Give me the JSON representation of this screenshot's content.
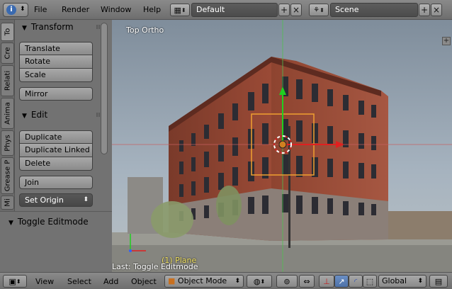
{
  "topbar": {
    "menus": [
      "File",
      "Render",
      "Window",
      "Help"
    ],
    "screen_layout": "Default",
    "scene": "Scene"
  },
  "tabs": [
    "Tools",
    "Create",
    "Relations",
    "Animation",
    "Physics",
    "Grease Pencil",
    "Misc"
  ],
  "tabs_short": [
    "To",
    "Cre",
    "Relati",
    "Anima",
    "Phys",
    "Grease P",
    "Mi"
  ],
  "transform_panel": {
    "title": "Transform",
    "buttons": [
      "Translate",
      "Rotate",
      "Scale",
      "Mirror"
    ]
  },
  "edit_panel": {
    "title": "Edit",
    "buttons": [
      "Duplicate",
      "Duplicate Linked",
      "Delete",
      "Join"
    ],
    "set_origin": "Set Origin"
  },
  "operator_panel": {
    "title": "Toggle Editmode"
  },
  "viewport": {
    "view_name": "Top Ortho",
    "object_label": "(1) Plane",
    "last_operator": "Last: Toggle Editmode"
  },
  "bottombar": {
    "menus": [
      "View",
      "Select",
      "Add",
      "Object"
    ],
    "mode": "Object Mode",
    "orientation": "Global"
  },
  "colors": {
    "background": "#727272",
    "selection": "#f0a030",
    "x_axis": "#e03030",
    "y_axis": "#30d030",
    "active_icon": "#5a7fb8"
  }
}
